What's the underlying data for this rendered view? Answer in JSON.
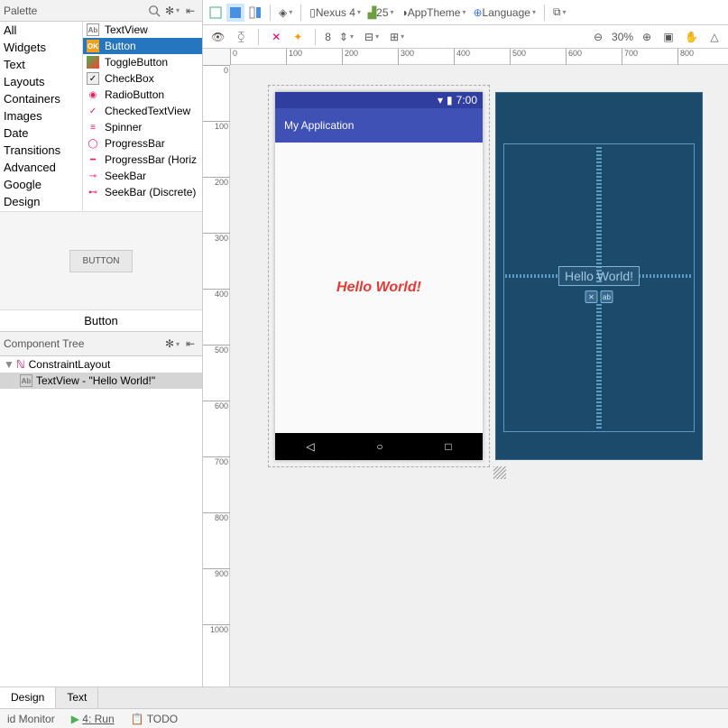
{
  "palette": {
    "title": "Palette",
    "categories": [
      "All",
      "Widgets",
      "Text",
      "Layouts",
      "Containers",
      "Images",
      "Date",
      "Transitions",
      "Advanced",
      "Google",
      "Design"
    ],
    "widgets": [
      {
        "icon": "ab",
        "label": "TextView"
      },
      {
        "icon": "ok",
        "label": "Button",
        "selected": true
      },
      {
        "icon": "tg",
        "label": "ToggleButton"
      },
      {
        "icon": "cb",
        "label": "CheckBox"
      },
      {
        "icon": "rb",
        "label": "RadioButton"
      },
      {
        "icon": "ct",
        "label": "CheckedTextView"
      },
      {
        "icon": "sp",
        "label": "Spinner"
      },
      {
        "icon": "pb",
        "label": "ProgressBar"
      },
      {
        "icon": "ph",
        "label": "ProgressBar (Horiz"
      },
      {
        "icon": "sk",
        "label": "SeekBar"
      },
      {
        "icon": "sd",
        "label": "SeekBar (Discrete)"
      }
    ],
    "preview_button": "BUTTON",
    "selected_widget": "Button"
  },
  "tree": {
    "title": "Component Tree",
    "root": "ConstraintLayout",
    "child_label": "TextView - \"Hello World!\""
  },
  "top_toolbar": {
    "device": "Nexus 4",
    "api": "25",
    "theme": "AppTheme",
    "language": "Language"
  },
  "sub_toolbar": {
    "margin": "8",
    "zoom": "30%"
  },
  "device_preview": {
    "time": "7:00",
    "app_title": "My Application",
    "hello": "Hello World!"
  },
  "blueprint": {
    "hello": "Hello World!"
  },
  "ruler_h": [
    "0",
    "100",
    "200",
    "300",
    "400",
    "500",
    "600",
    "700",
    "800"
  ],
  "ruler_v": [
    "0",
    "100",
    "200",
    "300",
    "400",
    "500",
    "600",
    "700",
    "800",
    "900",
    "1000"
  ],
  "bottom_tabs": {
    "design": "Design",
    "text": "Text"
  },
  "status": {
    "monitor": "id Monitor",
    "run": "4: Run",
    "todo": "TODO"
  }
}
